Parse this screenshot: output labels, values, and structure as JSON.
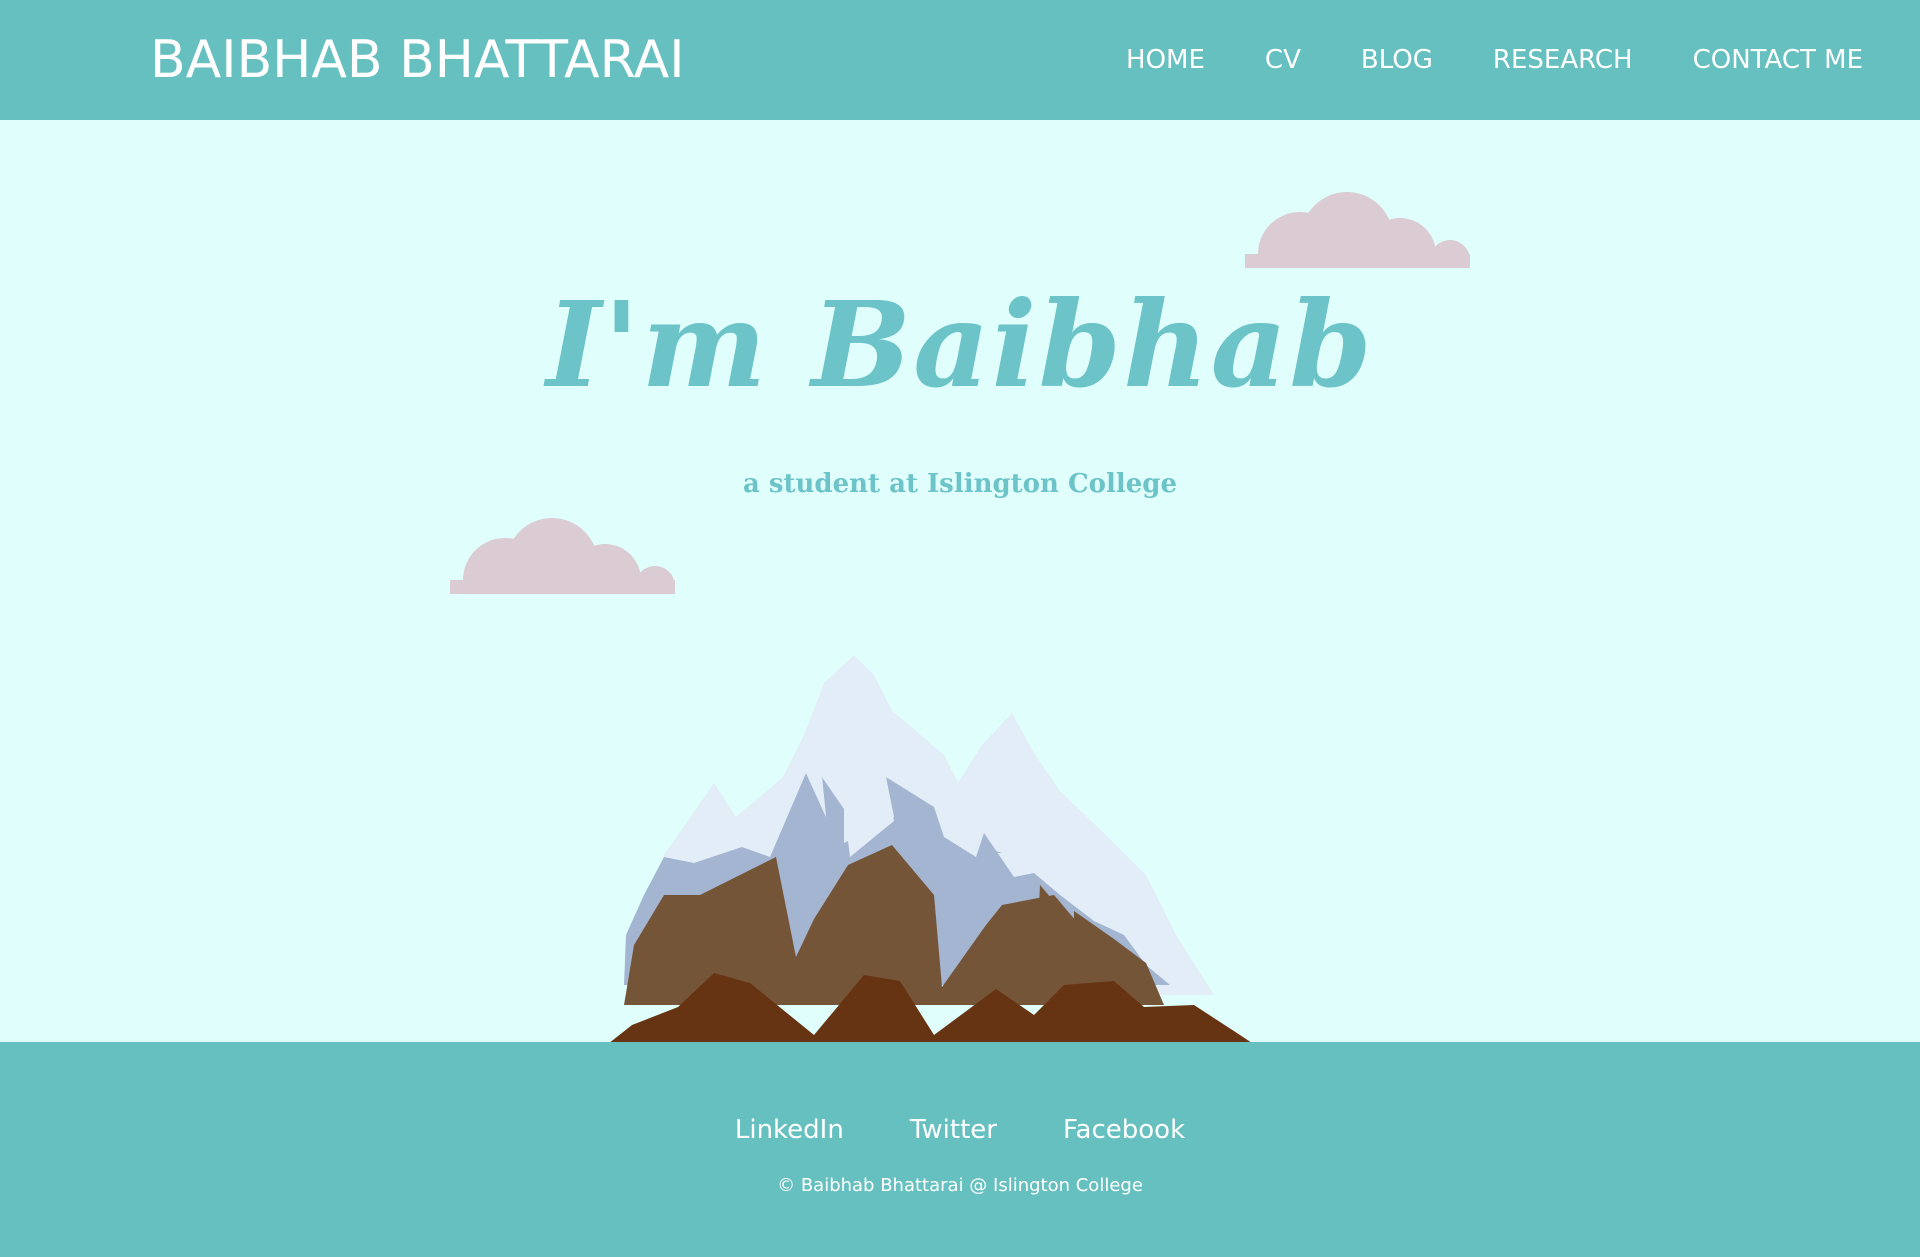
{
  "header": {
    "brand": "BAIBHAB BHATTARAI",
    "nav": [
      {
        "label": "HOME"
      },
      {
        "label": "CV"
      },
      {
        "label": "BLOG"
      },
      {
        "label": "RESEARCH"
      },
      {
        "label": "CONTACT ME"
      }
    ]
  },
  "hero": {
    "title": "I'm Baibhab",
    "subtitle": "a student at Islington College",
    "illustrations": [
      "cloud-icon",
      "cloud-icon",
      "mountain-icon"
    ]
  },
  "footer": {
    "social": [
      {
        "label": "LinkedIn"
      },
      {
        "label": "Twitter"
      },
      {
        "label": "Facebook"
      }
    ],
    "copyright": "© Baibhab Bhattarai @ Islington College"
  },
  "colors": {
    "header_bg": "#66c0c0",
    "page_bg": "#e0fffc",
    "accent_text": "#6cc3c8",
    "cloud": "#dbcbd2"
  }
}
